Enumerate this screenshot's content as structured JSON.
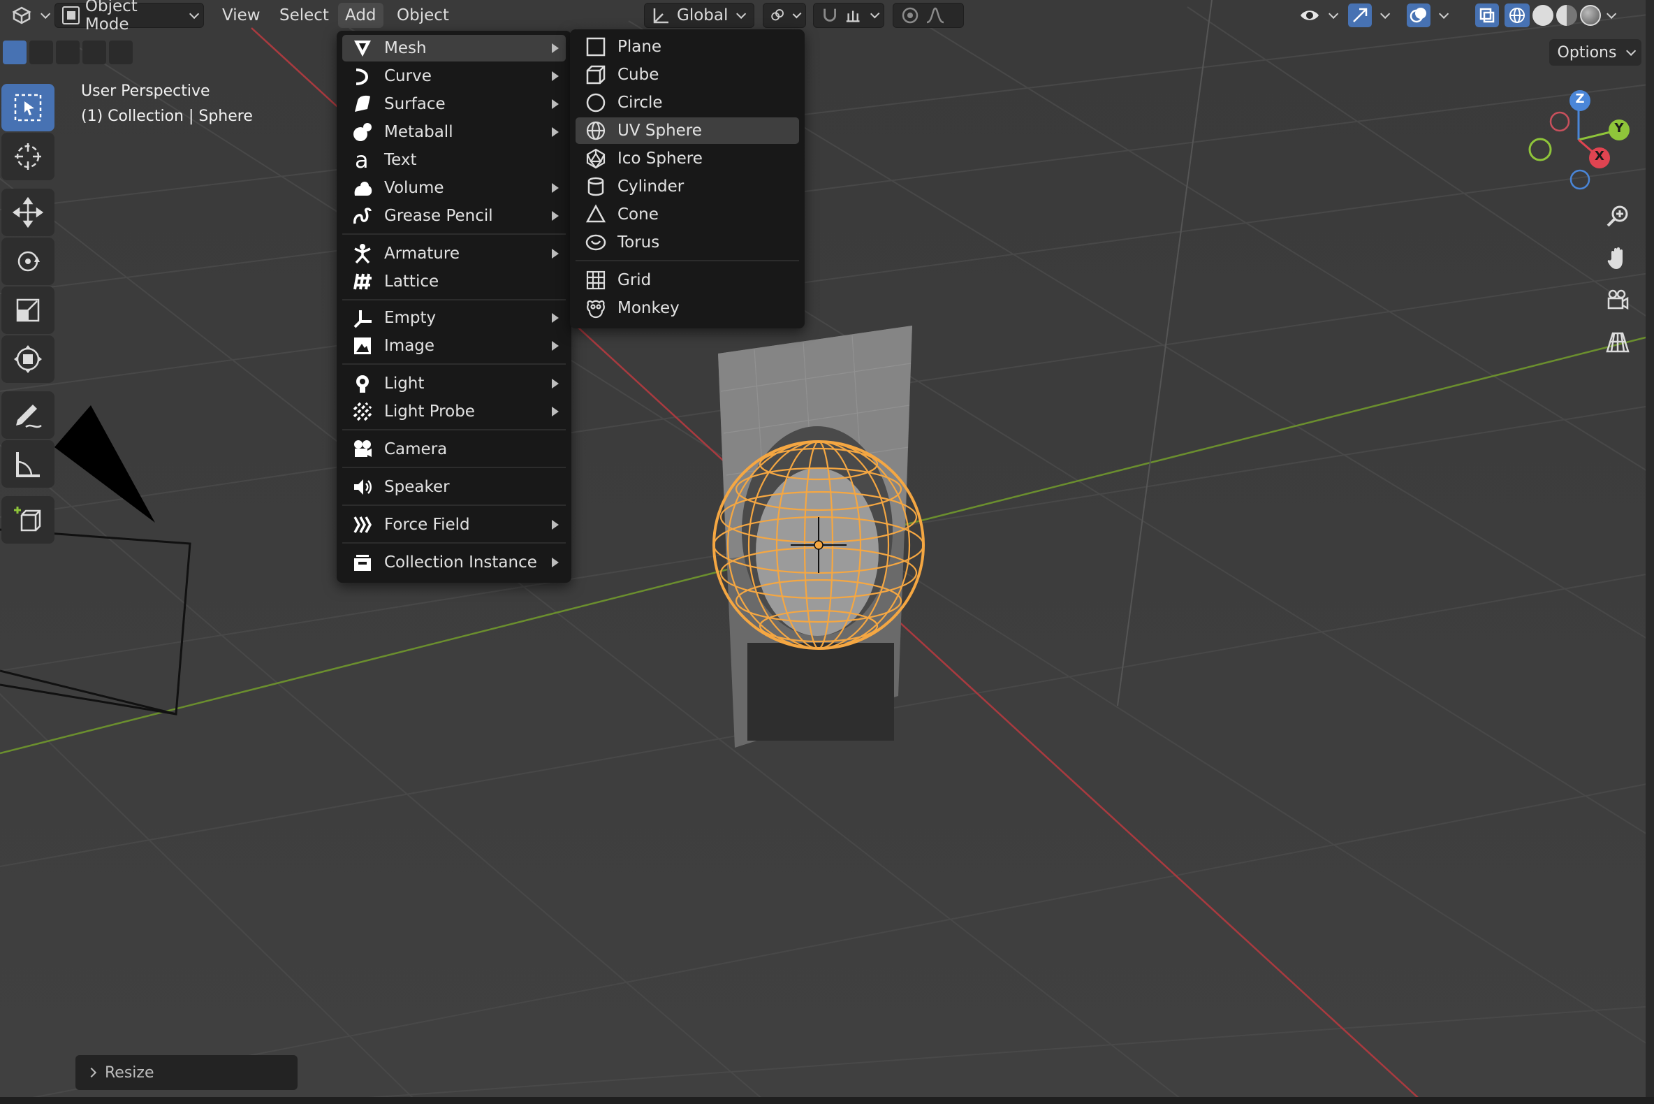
{
  "header": {
    "mode": "Object Mode",
    "menus": [
      "View",
      "Select",
      "Add",
      "Object"
    ],
    "active_menu": "Add",
    "orientation": "Global",
    "options_label": "Options"
  },
  "viewport": {
    "perspective": "User Perspective",
    "collection": "(1) Collection | Sphere"
  },
  "add_menu": {
    "items": [
      {
        "label": "Mesh",
        "icon": "mesh-icon",
        "submenu": true
      },
      {
        "label": "Curve",
        "icon": "curve-icon",
        "submenu": true
      },
      {
        "label": "Surface",
        "icon": "surface-icon",
        "submenu": true
      },
      {
        "label": "Metaball",
        "icon": "metaball-icon",
        "submenu": true
      },
      {
        "label": "Text",
        "icon": "text-icon",
        "submenu": false
      },
      {
        "label": "Volume",
        "icon": "volume-icon",
        "submenu": true
      },
      {
        "label": "Grease Pencil",
        "icon": "grease-pencil-icon",
        "submenu": true
      },
      {
        "label": "Armature",
        "icon": "armature-icon",
        "submenu": true
      },
      {
        "label": "Lattice",
        "icon": "lattice-icon",
        "submenu": false
      },
      {
        "label": "Empty",
        "icon": "empty-icon",
        "submenu": true
      },
      {
        "label": "Image",
        "icon": "image-icon",
        "submenu": true
      },
      {
        "label": "Light",
        "icon": "light-icon",
        "submenu": true
      },
      {
        "label": "Light Probe",
        "icon": "light-probe-icon",
        "submenu": true
      },
      {
        "label": "Camera",
        "icon": "camera-icon",
        "submenu": false
      },
      {
        "label": "Speaker",
        "icon": "speaker-icon",
        "submenu": false
      },
      {
        "label": "Force Field",
        "icon": "force-field-icon",
        "submenu": true
      },
      {
        "label": "Collection Instance",
        "icon": "collection-instance-icon",
        "submenu": true
      }
    ]
  },
  "mesh_menu": {
    "items": [
      {
        "label": "Plane",
        "icon": "plane-icon"
      },
      {
        "label": "Cube",
        "icon": "cube-icon"
      },
      {
        "label": "Circle",
        "icon": "circle-icon"
      },
      {
        "label": "UV Sphere",
        "icon": "uv-sphere-icon"
      },
      {
        "label": "Ico Sphere",
        "icon": "ico-sphere-icon"
      },
      {
        "label": "Cylinder",
        "icon": "cylinder-icon"
      },
      {
        "label": "Cone",
        "icon": "cone-icon"
      },
      {
        "label": "Torus",
        "icon": "torus-icon"
      },
      {
        "label": "Grid",
        "icon": "grid-icon"
      },
      {
        "label": "Monkey",
        "icon": "monkey-icon"
      }
    ],
    "highlighted": "UV Sphere"
  },
  "gizmo": {
    "x_label": "X",
    "y_label": "Y",
    "z_label": "Z"
  },
  "last_operator": "Resize",
  "colors": {
    "accent": "#4772b3",
    "selection": "#f5a742",
    "x_axis": "#e04451",
    "y_axis": "#8fc53a",
    "z_axis": "#4a86d8"
  }
}
